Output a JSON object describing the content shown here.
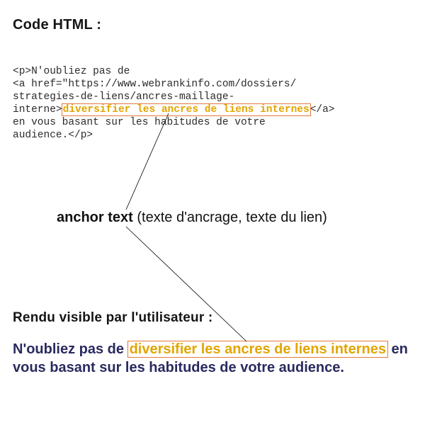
{
  "headings": {
    "code": "Code HTML :",
    "render": "Rendu visible par l'utilisateur :"
  },
  "code": {
    "l1": "<p>N'oubliez pas de",
    "l2": "<a href=\"https://www.webrankinfo.com/dossiers/",
    "l3": "strategies-de-liens/ancres-maillage-",
    "l4_pre": "interne>",
    "l4_hl": "diversifier les ancres de liens internes",
    "l4_post": "</a>",
    "l5": "en vous basant sur les habitudes de votre",
    "l6": "audience.</p>"
  },
  "anchor_label": {
    "bold": "anchor text",
    "rest": " (texte d'ancrage, texte du lien)"
  },
  "rendered": {
    "pre": "N'oubliez pas de ",
    "link": "diversifier les ancres de liens internes",
    "post1": " en vous basant sur les habitudes de votre audience."
  }
}
